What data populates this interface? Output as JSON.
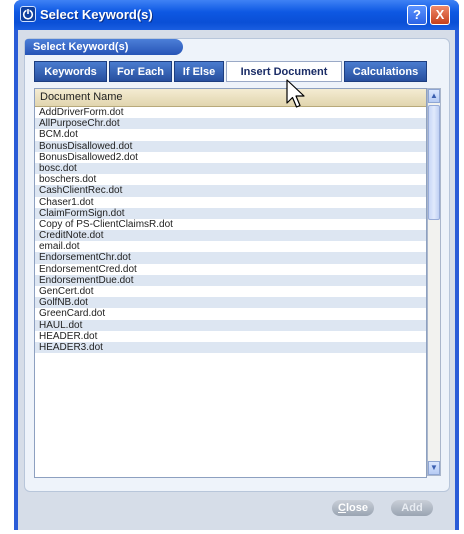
{
  "window": {
    "title": "Select Keyword(s)",
    "help_label": "?",
    "close_label": "X"
  },
  "panel": {
    "header": "Select Keyword(s)"
  },
  "tabs": [
    {
      "label": "Keywords"
    },
    {
      "label": "For Each"
    },
    {
      "label": "If Else"
    },
    {
      "label": "Insert Document"
    },
    {
      "label": "Calculations"
    }
  ],
  "active_tab": "Insert Document",
  "list": {
    "column_header": "Document Name",
    "rows": [
      "AddDriverForm.dot",
      "AllPurposeChr.dot",
      "BCM.dot",
      "BonusDisallowed.dot",
      "BonusDisallowed2.dot",
      "bosc.dot",
      "boschers.dot",
      "CashClientRec.dot",
      "Chaser1.dot",
      "ClaimFormSign.dot",
      "Copy of PS-ClientClaimsR.dot",
      "CreditNote.dot",
      "email.dot",
      "EndorsementChr.dot",
      "EndorsementCred.dot",
      "EndorsementDue.dot",
      "GenCert.dot",
      "GolfNB.dot",
      "GreenCard.dot",
      "HAUL.dot",
      "HEADER.dot",
      "HEADER3.dot"
    ]
  },
  "footer": {
    "close_prefix": "",
    "close_underlined": "C",
    "close_rest": "lose",
    "add_label": "Add"
  },
  "colors": {
    "title_bar": "#0a4fd6",
    "tab_bg": "#2f5fb5",
    "tab_active_bg": "#ffffff",
    "row_alt": "#dde6f2",
    "header_bg": "#ece2c2"
  }
}
